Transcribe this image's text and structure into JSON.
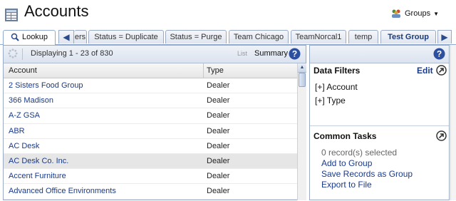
{
  "header": {
    "title": "Accounts",
    "groups_label": "Groups"
  },
  "tabs": [
    {
      "label": "Lookup",
      "active": true
    },
    {
      "label": "ers"
    },
    {
      "label": "Status = Duplicate"
    },
    {
      "label": "Status = Purge"
    },
    {
      "label": "Team Chicago"
    },
    {
      "label": "TeamNorcal1"
    },
    {
      "label": "temp"
    },
    {
      "label": "Test Group",
      "bold": true
    }
  ],
  "toolbar": {
    "displaying": "Displaying 1 - 23 of 830",
    "list_label": "List",
    "summary_label": "Summary"
  },
  "table": {
    "columns": [
      "Account",
      "Type"
    ],
    "rows": [
      {
        "account": "2 Sisters Food Group",
        "type": "Dealer"
      },
      {
        "account": "366 Madison",
        "type": "Dealer"
      },
      {
        "account": "A-Z GSA",
        "type": "Dealer"
      },
      {
        "account": "ABR",
        "type": "Dealer"
      },
      {
        "account": "AC Desk",
        "type": "Dealer"
      },
      {
        "account": "AC Desk Co. Inc.",
        "type": "Dealer",
        "selected": true
      },
      {
        "account": "Accent Furniture",
        "type": "Dealer"
      },
      {
        "account": "Advanced Office Environments",
        "type": "Dealer"
      }
    ]
  },
  "filters": {
    "title": "Data Filters",
    "edit_label": "Edit",
    "items": [
      "[+] Account",
      "[+] Type"
    ]
  },
  "tasks": {
    "title": "Common Tasks",
    "selected_text": "0 record(s) selected",
    "links": [
      "Add to Group",
      "Save Records as Group",
      "Export to File"
    ]
  },
  "colors": {
    "link": "#1a3a8a",
    "tab_border": "#9aaac4",
    "help_blue": "#2d4fa0"
  },
  "icons": {
    "app": "accounts-table-icon",
    "groups": "groups-people-icon",
    "lookup": "magnifier-icon",
    "help": "help-icon",
    "arrow": "circle-arrow-icon"
  }
}
